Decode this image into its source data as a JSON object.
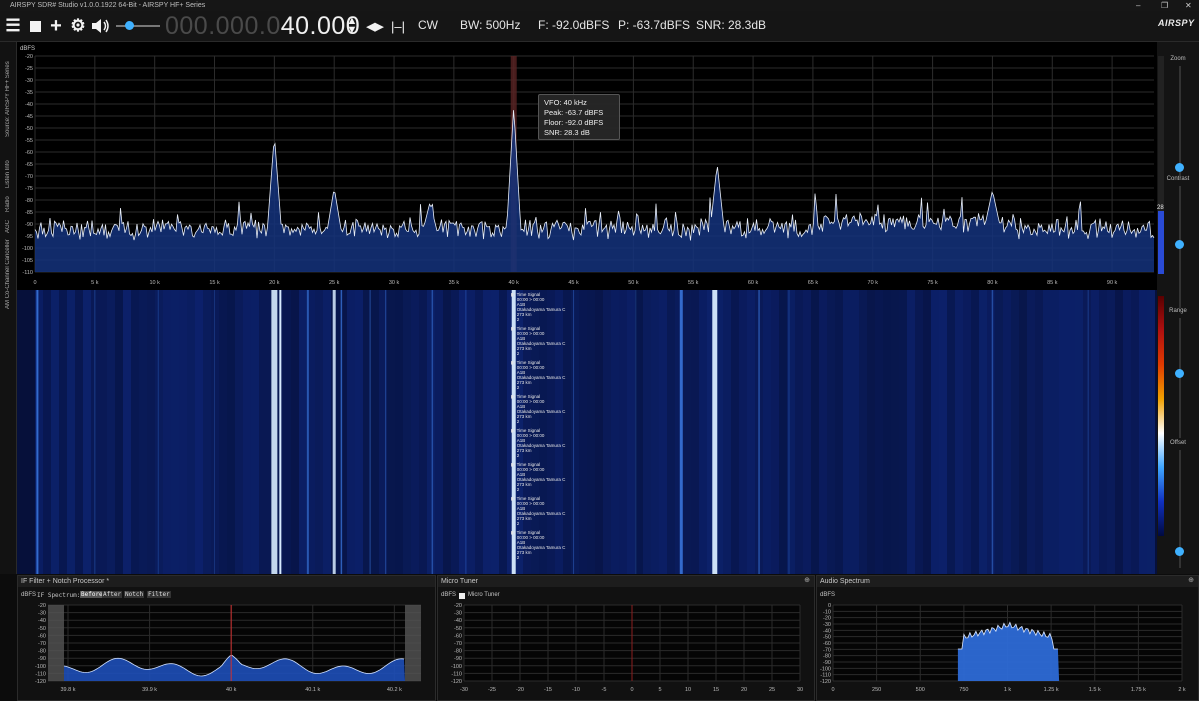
{
  "window": {
    "title": "AIRSPY SDR# Studio v1.0.0.1922 64-Bit - AIRSPY HF+ Series"
  },
  "toolbar": {
    "freq_dim": "000.000.0",
    "freq_lit": "40.000",
    "mode": "CW",
    "bw": "BW: 500Hz",
    "floor": "F: -92.0dBFS",
    "peak": "P: -63.7dBFS",
    "snr": "SNR: 28.3dB",
    "brand": "AIRSPY",
    "volume": 0.3
  },
  "left_tabs": [
    "Source: AIRSPY HF+ Series",
    "Listen Info",
    "Radio",
    "AGC",
    "AM Co-Channel Canceller"
  ],
  "right_panel": {
    "zoom": "Zoom",
    "contrast": "Contrast",
    "range": "Range",
    "offset": "Offset",
    "level": "28"
  },
  "spectrum": {
    "unit": "dBFS",
    "y_ticks": [
      "-20",
      "-25",
      "-30",
      "-35",
      "-40",
      "-45",
      "-50",
      "-55",
      "-60",
      "-65",
      "-70",
      "-75",
      "-80",
      "-85",
      "-90",
      "-95",
      "-100",
      "-105",
      "-110"
    ],
    "x_ticks": [
      "0",
      "5 k",
      "10 k",
      "15 k",
      "20 k",
      "25 k",
      "30 k",
      "35 k",
      "40 k",
      "45 k",
      "50 k",
      "55 k",
      "60 k",
      "65 k",
      "70 k",
      "75 k",
      "80 k",
      "85 k",
      "90 k"
    ],
    "tooltip": {
      "vfo": "VFO:  40 kHz",
      "peak": "Peak:  -63.7 dBFS",
      "floor": "Floor:  -92.0 dBFS",
      "snr": "SNR:  28.3 dB"
    }
  },
  "waterfall": {
    "labels": [
      {
        "title": "Time Signal",
        "time": "00:00 > 00:00",
        "code": "A1B",
        "station": "Otakadoyama Tamura C",
        "dist": "273 km",
        "n": "2"
      },
      {
        "title": "Time Signal",
        "time": "00:00 > 00:00",
        "code": "A1B",
        "station": "Otakadoyama Tamura C",
        "dist": "273 km",
        "n": "2"
      },
      {
        "title": "Time Signal",
        "time": "00:00 > 00:00",
        "code": "A1B",
        "station": "Otakadoyama Tamura C",
        "dist": "273 km",
        "n": "2"
      },
      {
        "title": "Time Signal",
        "time": "00:00 > 00:00",
        "code": "A1B",
        "station": "Otakadoyama Tamura C",
        "dist": "273 km",
        "n": "2"
      },
      {
        "title": "Time Signal",
        "time": "00:00 > 00:00",
        "code": "A1B",
        "station": "Otakadoyama Tamura C",
        "dist": "273 km",
        "n": "2"
      },
      {
        "title": "Time Signal",
        "time": "00:00 > 00:00",
        "code": "A1B",
        "station": "Otakadoyama Tamura C",
        "dist": "273 km",
        "n": "2"
      },
      {
        "title": "Time Signal",
        "time": "00:00 > 00:00",
        "code": "A1B",
        "station": "Otakadoyama Tamura C",
        "dist": "273 km",
        "n": "2"
      },
      {
        "title": "Time Signal",
        "time": "00:00 > 00:00",
        "code": "A1B",
        "station": "Otakadoyama Tamura C",
        "dist": "273 km",
        "n": "2"
      }
    ]
  },
  "if_panel": {
    "title": "IF Filter + Notch Processor *",
    "unit": "dBFS",
    "spectrum_label": "IF Spectrum:",
    "buttons": [
      "Before",
      "After",
      "Notch",
      "Filter"
    ],
    "y_ticks": [
      "-20",
      "-30",
      "-40",
      "-50",
      "-60",
      "-70",
      "-80",
      "-90",
      "-100",
      "-110",
      "-120"
    ],
    "x_ticks": [
      "39.8 k",
      "39.9 k",
      "40 k",
      "40.1 k",
      "40.2 k"
    ]
  },
  "micro_tuner": {
    "title": "Micro Tuner",
    "unit": "dBFS",
    "checkbox": "Micro Tuner",
    "checked": false,
    "y_ticks": [
      "-20",
      "-30",
      "-40",
      "-50",
      "-60",
      "-70",
      "-80",
      "-90",
      "-100",
      "-110",
      "-120"
    ],
    "x_ticks": [
      "-30",
      "-25",
      "-20",
      "-15",
      "-10",
      "-5",
      "0",
      "5",
      "10",
      "15",
      "20",
      "25",
      "30"
    ]
  },
  "audio": {
    "title": "Audio Spectrum",
    "unit": "dBFS",
    "y_ticks": [
      "0",
      "-10",
      "-20",
      "-30",
      "-40",
      "-50",
      "-60",
      "-70",
      "-80",
      "-90",
      "-100",
      "-110",
      "-120"
    ],
    "x_ticks": [
      "0",
      "250",
      "500",
      "750",
      "1 k",
      "1.25 k",
      "1.5 k",
      "1.75 k",
      "2 k"
    ]
  },
  "colors": {
    "accent": "#3fb1ff",
    "marker": "#c0392b",
    "trace": "#e8eef8",
    "fill": "#1a3aa0",
    "waterfall": "#06103a"
  }
}
